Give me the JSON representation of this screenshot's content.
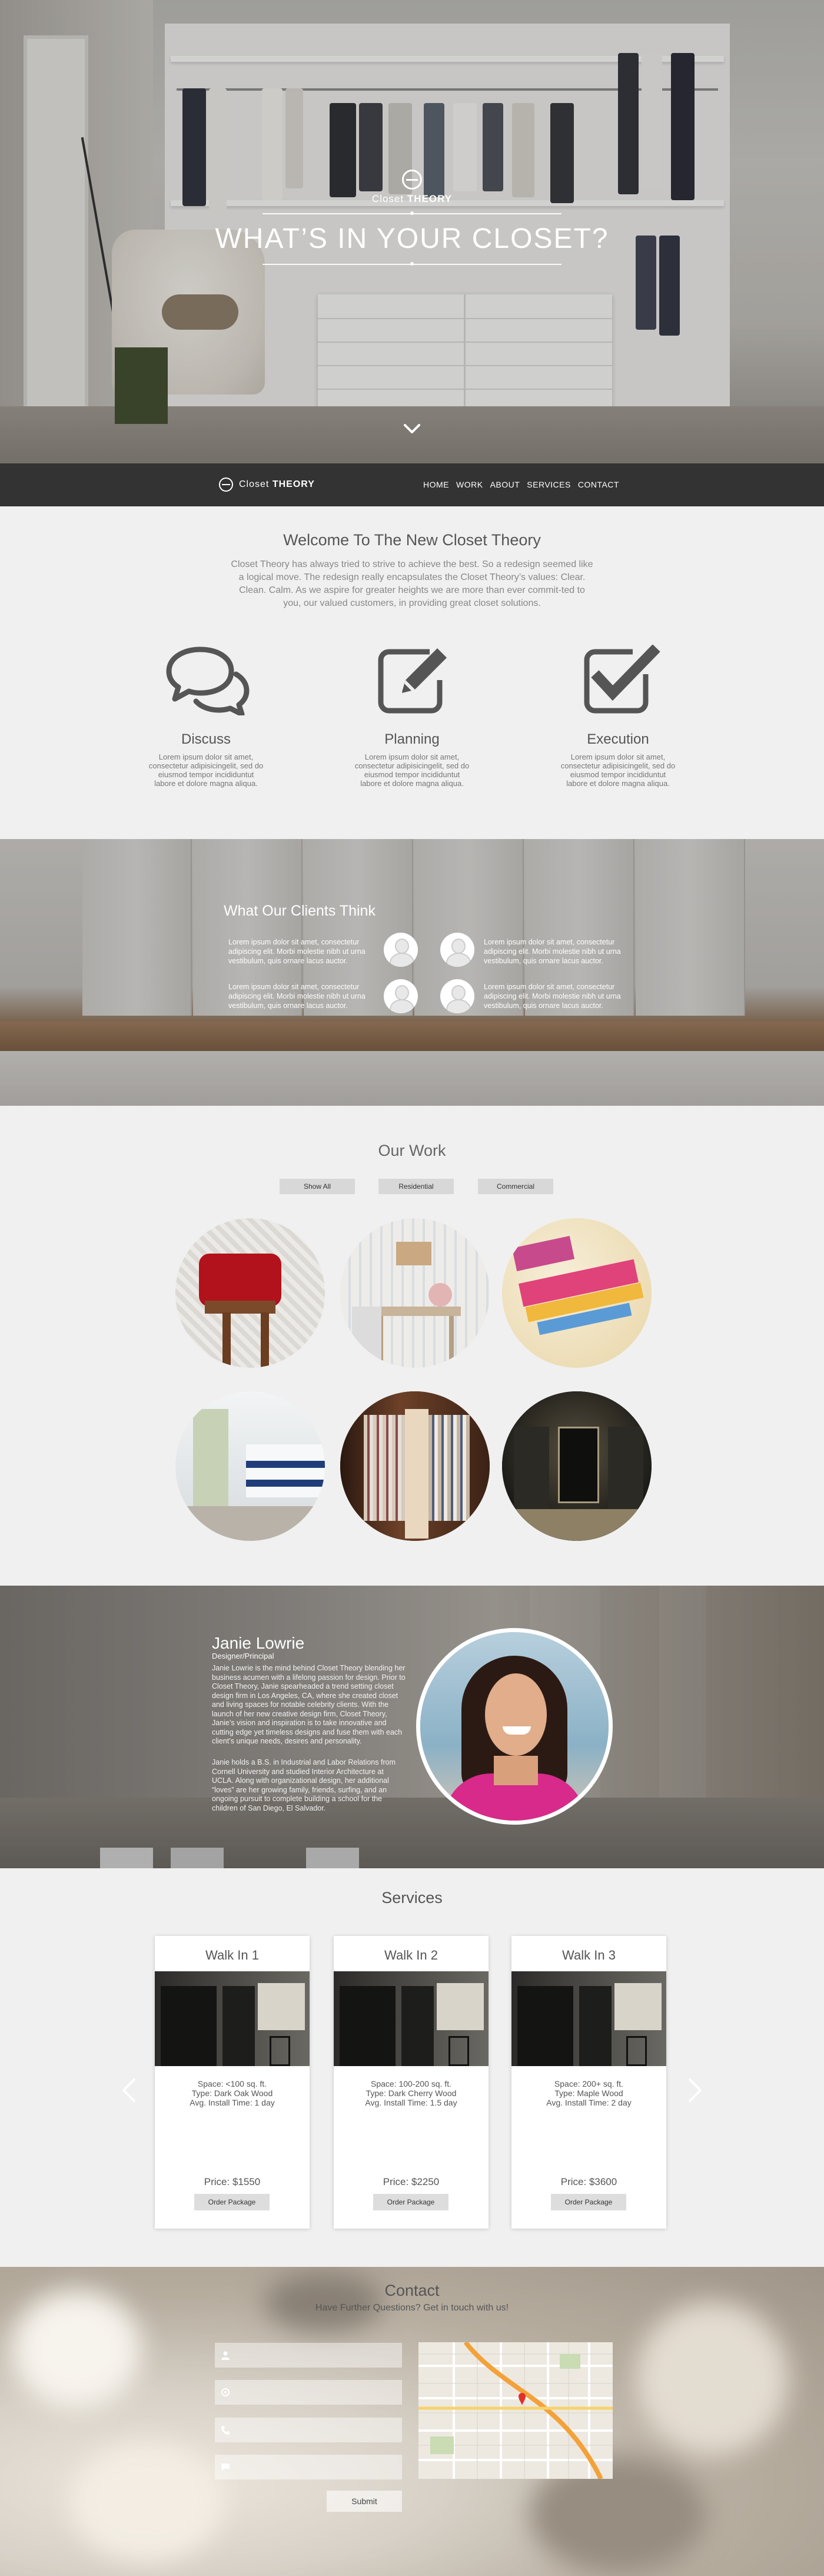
{
  "hero": {
    "logo_light": "Closet",
    "logo_bold": "THEORY",
    "headline": "WHAT’S IN YOUR CLOSET?"
  },
  "nav": {
    "brand_light": "Closet",
    "brand_bold": "THEORY",
    "items": [
      "HOME",
      "WORK",
      "ABOUT",
      "SERVICES",
      "CONTACT"
    ]
  },
  "welcome": {
    "title": "Welcome To The New Closet Theory",
    "lead": "Closet Theory has always tried to strive to achieve the best. So a redesign seemed like a logical move. The redesign really encapsulates the Closet Theory’s values: Clear. Clean. Calm. As we aspire for greater heights we are more than ever commit-ted to you, our valued customers, in providing great closet solutions.",
    "features": [
      {
        "title": "Discuss",
        "text": "Lorem ipsum dolor sit amet, consectetur adipisicingelit, sed do eiusmod tempor incididuntut labore et dolore magna aliqua.",
        "icon": "chat-bubbles-icon"
      },
      {
        "title": "Planning",
        "text": "Lorem ipsum dolor sit amet, consectetur adipisicingelit, sed do eiusmod tempor incididuntut labore et dolore magna aliqua.",
        "icon": "pencil-square-icon"
      },
      {
        "title": "Execution",
        "text": "Lorem ipsum dolor sit amet, consectetur adipisicingelit, sed do eiusmod tempor incididuntut labore et dolore magna aliqua.",
        "icon": "checkbox-icon"
      }
    ]
  },
  "clients": {
    "title": "What Our Clients Think",
    "quotes": [
      "Lorem ipsum dolor sit amet, consectetur adipiscing elit. Morbi molestie nibh ut urna vestibulum, quis ornare lacus auctor.",
      "Lorem ipsum dolor sit amet, consectetur adipiscing elit. Morbi molestie nibh ut urna vestibulum, quis ornare lacus auctor.",
      "Lorem ipsum dolor sit amet, consectetur adipiscing elit. Morbi molestie nibh ut urna vestibulum, quis ornare lacus auctor.",
      "Lorem ipsum dolor sit amet, consectetur adipiscing elit. Morbi molestie nibh ut urna vestibulum, quis ornare lacus auctor."
    ]
  },
  "work": {
    "title": "Our Work",
    "filters": [
      "Show All",
      "Residential",
      "Commercial"
    ]
  },
  "about": {
    "name": "Janie Lowrie",
    "role": "Designer/Principal",
    "para1": "Janie Lowrie is the mind behind Closet Theory blending her business acumen with a lifelong passion for design. Prior to Closet Theory, Janie spearheaded a trend setting closet design firm in Los Angeles, CA, where she created closet and living spaces for notable celebrity clients. With the launch of her new creative design firm, Closet Theory, Janie’s vision and inspiration is to take innovative and cutting edge yet timeless designs and fuse them with each client’s unique needs, desires and personality.",
    "para2": "Janie holds a B.S. in Industrial and Labor Relations from Cornell University and studied Interior Architecture at UCLA. Along with organizational design, her additional “loves” are her growing family, friends, surfing, and an ongoing pursuit to complete building a school for the children of San Diego, El Salvador."
  },
  "services": {
    "title": "Services",
    "cards": [
      {
        "name": "Walk In 1",
        "spec1": "Space: <100 sq. ft.",
        "spec2": "Type: Dark Oak Wood",
        "spec3": "Avg. Install Time: 1 day",
        "price": "Price: $1550",
        "button": "Order Package"
      },
      {
        "name": "Walk In 2",
        "spec1": "Space: 100-200 sq. ft.",
        "spec2": "Type: Dark Cherry Wood",
        "spec3": "Avg. Install Time: 1.5 day",
        "price": "Price: $2250",
        "button": "Order Package"
      },
      {
        "name": "Walk In 3",
        "spec1": "Space: 200+ sq. ft.",
        "spec2": "Type: Maple Wood",
        "spec3": "Avg. Install Time: 2 day",
        "price": "Price: $3600",
        "button": "Order Package"
      }
    ]
  },
  "contact": {
    "title": "Contact",
    "subtitle": "Have Further Questions? Get in touch with us!",
    "fields": [
      "user-icon",
      "email-icon",
      "phone-icon",
      "message-icon"
    ],
    "submit": "Submit"
  },
  "colors": {
    "nav_bg": "#333333",
    "page_bg": "#f0f0f0",
    "icon_gray": "#555555",
    "button_gray": "#d8d8d8"
  }
}
